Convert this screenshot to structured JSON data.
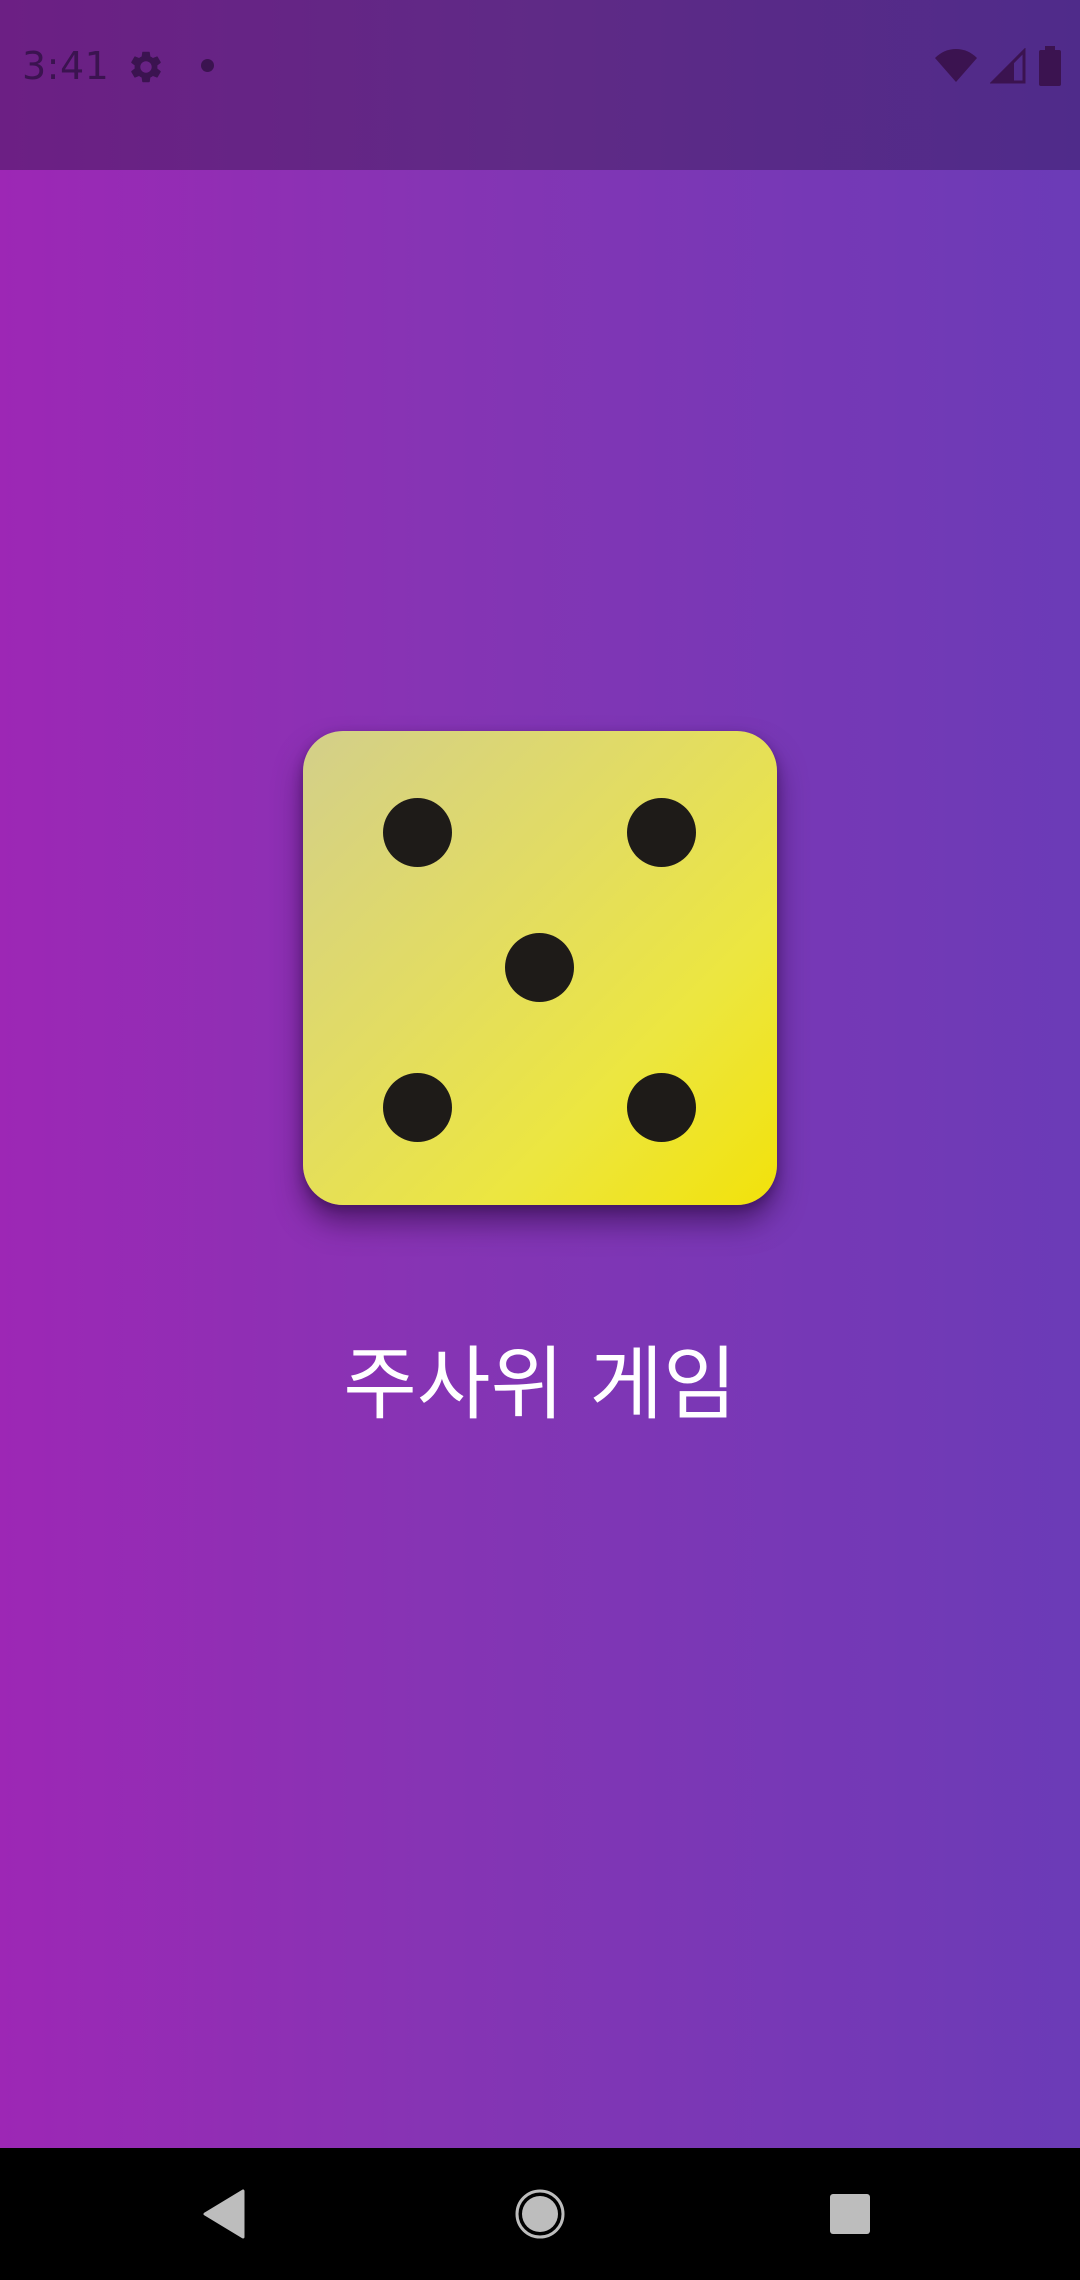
{
  "status_bar": {
    "time": "3:41",
    "left_icons": [
      "gear-icon",
      "notification-dot-icon"
    ],
    "right_icons": [
      "wifi-icon",
      "cellular-signal-icon",
      "battery-icon"
    ]
  },
  "dice": {
    "face_value": 5,
    "face_color": "#eee640",
    "pip_color": "#1e1b18"
  },
  "title": "주사위 게임",
  "navigation_bar": {
    "buttons": [
      "back-icon",
      "home-icon",
      "recents-icon"
    ]
  },
  "colors": {
    "background_left": "#9d27b5",
    "background_right": "#6b3bb7",
    "status_bar": "#5f2a86",
    "title_text": "#ffffff"
  }
}
